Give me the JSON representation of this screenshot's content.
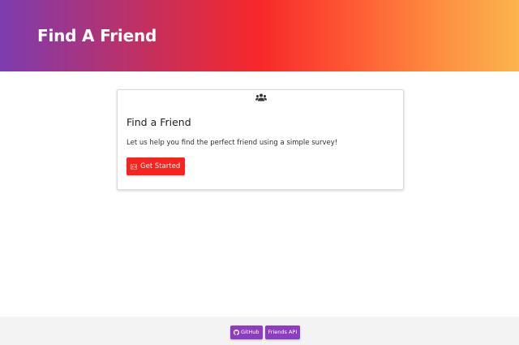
{
  "header": {
    "title": "Find A Friend"
  },
  "card": {
    "icon": "users-icon",
    "title": "Find a Friend",
    "text": "Let us help you find the perfect friend using a simple survey!",
    "button": {
      "icon": "id-card-icon",
      "label": "Get Started"
    }
  },
  "footer": {
    "links": [
      {
        "icon": "github-icon",
        "label": "GitHub"
      },
      {
        "label": "Friends API"
      }
    ]
  },
  "colors": {
    "gradient": [
      "#7d3cb0",
      "#f7282a",
      "#fcb44e"
    ],
    "primary_button": "#f7231e",
    "footer_button": "#8d3dbf",
    "footer_bg": "#f3f3f3"
  }
}
